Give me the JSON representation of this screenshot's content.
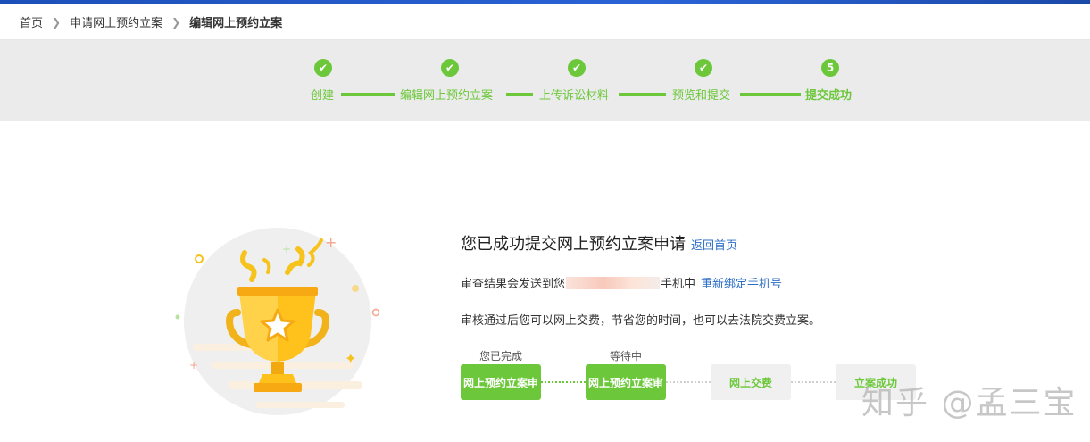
{
  "breadcrumb": {
    "items": [
      "首页",
      "申请网上预约立案",
      "编辑网上预约立案"
    ]
  },
  "steps": [
    {
      "label": "创建",
      "status": "done"
    },
    {
      "label": "编辑网上预约立案",
      "status": "done"
    },
    {
      "label": "上传诉讼材料",
      "status": "done"
    },
    {
      "label": "预览和提交",
      "status": "done"
    },
    {
      "label": "提交成功",
      "status": "current",
      "number": "5"
    }
  ],
  "success": {
    "title": "您已成功提交网上预约立案申请",
    "return_link": "返回首页",
    "notice_prefix": "审查结果会发送到您",
    "notice_suffix": "手机中",
    "rebind_link": "重新绑定手机号",
    "info": "审核通过后您可以网上交费，节省您的时间，也可以去法院交费立案。"
  },
  "flow": {
    "stages": [
      {
        "status_label": "您已完成",
        "box": "网上预约立案申",
        "state": "done"
      },
      {
        "status_label": "等待中",
        "box": "网上预约立案审",
        "state": "done"
      },
      {
        "status_label": "",
        "box": "网上交费",
        "state": "todo"
      },
      {
        "status_label": "",
        "box": "立案成功",
        "state": "todo"
      }
    ]
  },
  "watermark": "知乎 @孟三宝",
  "colors": {
    "accent": "#6cc83a",
    "link": "#2e6fc6",
    "topbar": "#2a63d6"
  }
}
